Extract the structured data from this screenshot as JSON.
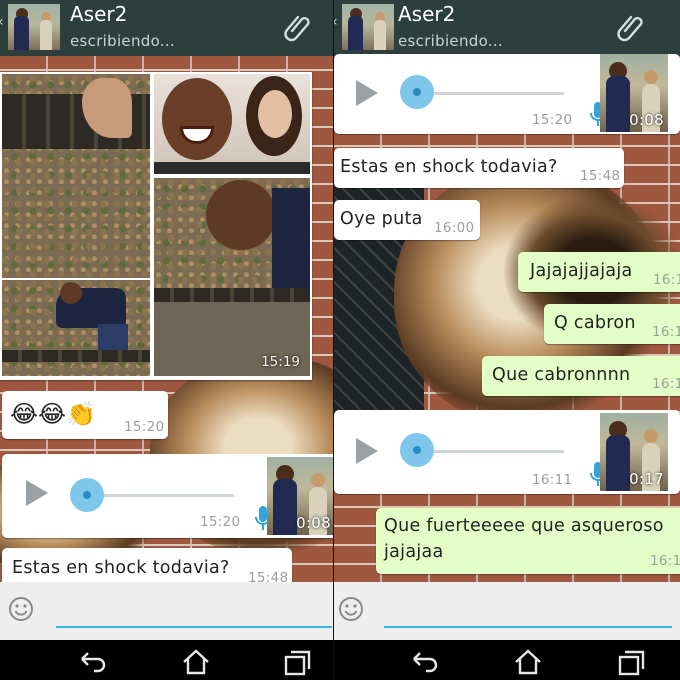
{
  "colors": {
    "header_bg": "#2c3f3d",
    "incoming_bubble": "#ffffff",
    "outgoing_bubble": "#e2ffc8",
    "voice_accent": "#7ec6ea",
    "input_underline": "#33b5e5",
    "nav_bg": "#000000"
  },
  "left": {
    "header": {
      "contact_name": "Aser2",
      "status": "escribiendo..."
    },
    "collage": {
      "time": "15:19"
    },
    "emoji_message": {
      "emojis": "😂😂👏",
      "time": "15:20"
    },
    "voice_message": {
      "time": "15:20",
      "duration": "0:08",
      "progress": 0.12
    },
    "partial_message": {
      "text": "Estas en shock todavia?",
      "time": "15:48"
    },
    "input": {
      "placeholder": ""
    }
  },
  "right": {
    "header": {
      "contact_name": "Aser2",
      "status": "escribiendo..."
    },
    "voice_message_top": {
      "time": "15:20",
      "duration": "0:08",
      "progress": 0.12
    },
    "messages": [
      {
        "text": "Estas en shock todavia?",
        "time": "15:48",
        "direction": "in"
      },
      {
        "text": "Oye puta",
        "time": "16:00",
        "direction": "in"
      },
      {
        "text": "Jajajajjajaja",
        "time": "16:1",
        "direction": "out"
      },
      {
        "text": "Q cabron",
        "time": "16:1",
        "direction": "out"
      },
      {
        "text": "Que cabronnnn",
        "time": "16:1",
        "direction": "out"
      }
    ],
    "voice_message": {
      "time": "16:11",
      "duration": "0:17",
      "progress": 0.1
    },
    "last_message": {
      "line1": "Que fuerteeeee que asqueroso",
      "line2": "jajajaa",
      "time": "16:1"
    },
    "input": {
      "placeholder": ""
    }
  },
  "icons": {
    "attach": "paperclip-icon",
    "emoji": "smiley-icon",
    "play": "play-icon",
    "mic": "microphone-icon",
    "nav_back": "back-arrow-icon",
    "nav_home": "home-icon",
    "nav_recents": "recent-apps-icon"
  }
}
